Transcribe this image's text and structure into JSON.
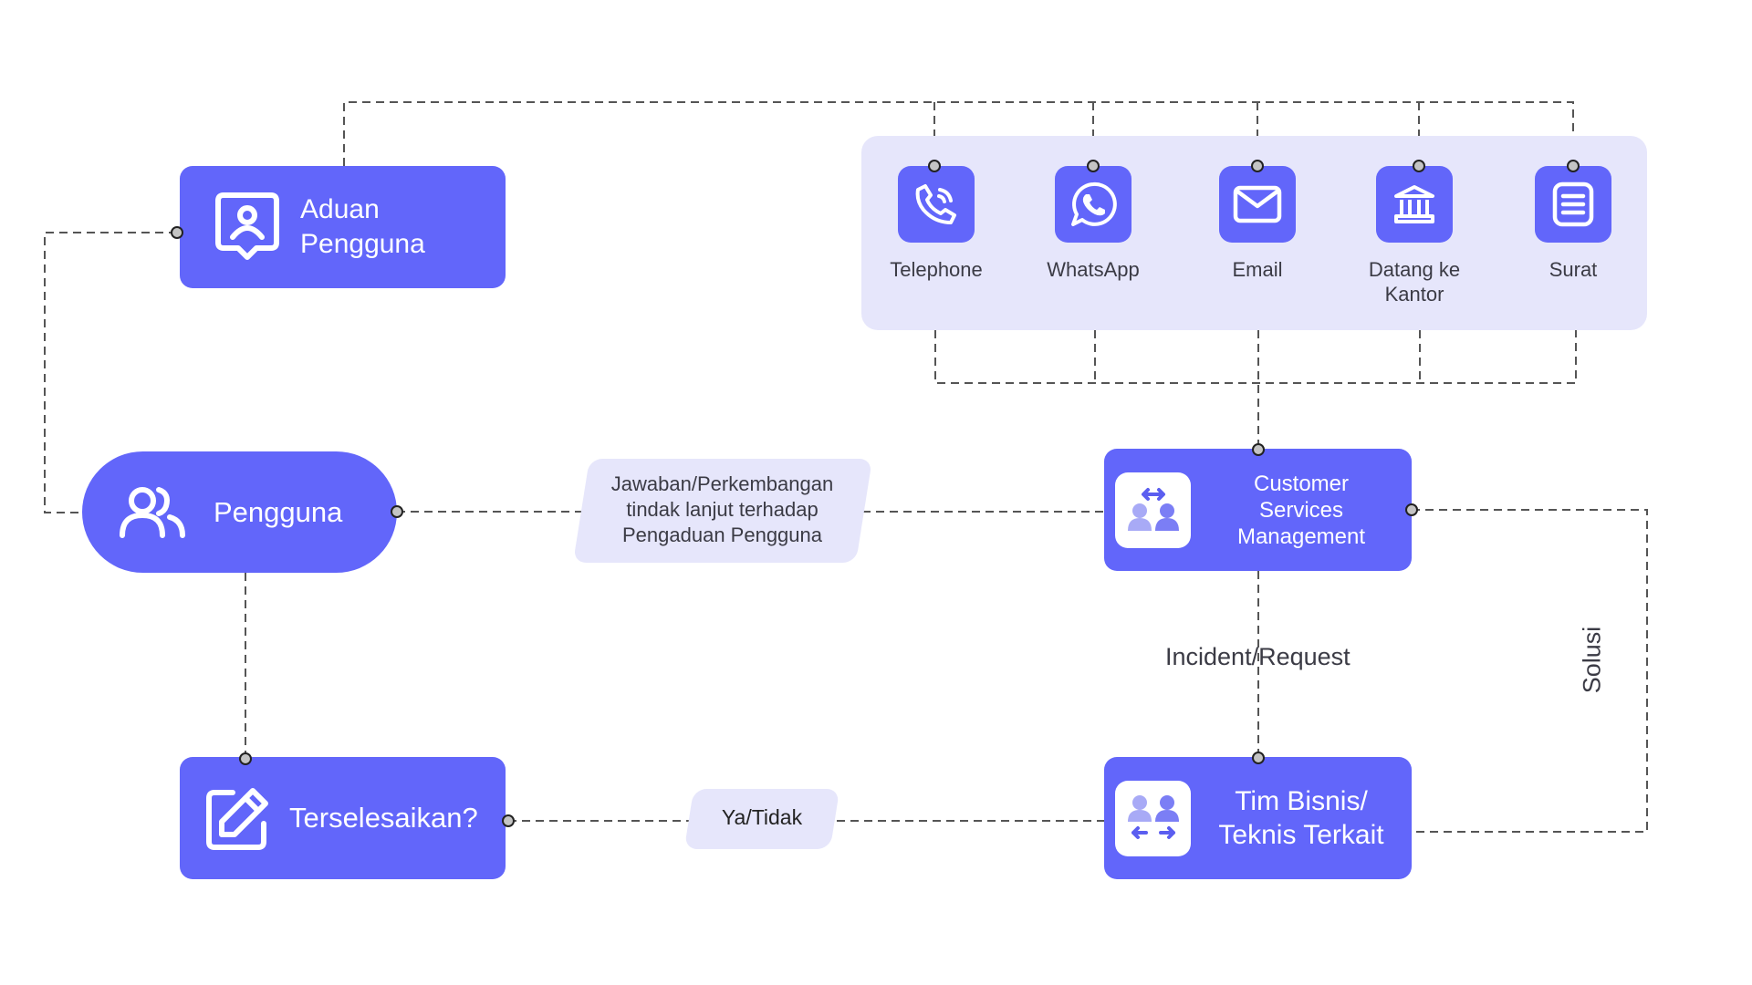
{
  "nodes": {
    "aduan": {
      "line1": "Aduan",
      "line2": "Pengguna",
      "icon": "user-complaint-icon"
    },
    "pengguna": {
      "label": "Pengguna",
      "icon": "users-icon"
    },
    "terselesaikan": {
      "label": "Terselesaikan?",
      "icon": "edit-icon"
    },
    "csm": {
      "line1": "Customer",
      "line2": "Services",
      "line3": "Management",
      "icon": "customer-exchange-icon"
    },
    "tim": {
      "line1": "Tim Bisnis/",
      "line2": "Teknis Terkait",
      "icon": "team-transfer-icon"
    }
  },
  "channels": [
    {
      "label": "Telephone",
      "icon": "phone-call-icon"
    },
    {
      "label": "WhatsApp",
      "icon": "whatsapp-icon"
    },
    {
      "label": "Email",
      "icon": "mail-icon"
    },
    {
      "label": "Datang ke",
      "label2": "Kantor",
      "icon": "bank-icon"
    },
    {
      "label": "Surat",
      "icon": "letter-icon"
    }
  ],
  "edge_labels": {
    "jawaban": [
      "Jawaban/Perkembangan",
      "tindak lanjut terhadap",
      "Pengaduan Pengguna"
    ],
    "ya_tidak": "Ya/Tidak",
    "incident": "Incident/Request",
    "solusi": "Solusi"
  },
  "colors": {
    "primary": "#6266FA",
    "panel": "#E6E6FB",
    "line": "#555555"
  }
}
